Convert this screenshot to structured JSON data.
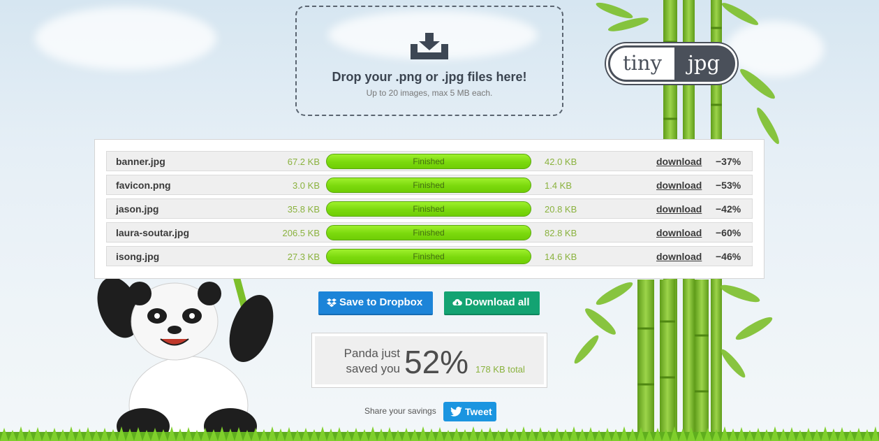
{
  "dropzone": {
    "icon": "download-tray-icon",
    "title": "Drop your .png or .jpg files here!",
    "subtitle": "Up to 20 images, max 5 MB each."
  },
  "logo": {
    "left": "tiny",
    "right": "jpg"
  },
  "files": [
    {
      "name": "banner.jpg",
      "original": "67.2 KB",
      "status": "Finished",
      "progress": 100,
      "compressed": "42.0 KB",
      "link": "download",
      "saving": "−37%"
    },
    {
      "name": "favicon.png",
      "original": "3.0 KB",
      "status": "Finished",
      "progress": 100,
      "compressed": "1.4 KB",
      "link": "download",
      "saving": "−53%"
    },
    {
      "name": "jason.jpg",
      "original": "35.8 KB",
      "status": "Finished",
      "progress": 100,
      "compressed": "20.8 KB",
      "link": "download",
      "saving": "−42%"
    },
    {
      "name": "laura-soutar.jpg",
      "original": "206.5 KB",
      "status": "Finished",
      "progress": 100,
      "compressed": "82.8 KB",
      "link": "download",
      "saving": "−60%"
    },
    {
      "name": "isong.jpg",
      "original": "27.3 KB",
      "status": "Finished",
      "progress": 100,
      "compressed": "14.6 KB",
      "link": "download",
      "saving": "−46%"
    }
  ],
  "actions": {
    "dropbox_label": "Save to Dropbox",
    "download_all_label": "Download all"
  },
  "savings": {
    "label_line1": "Panda just",
    "label_line2": "saved you",
    "percent": "52%",
    "total": "178 KB total"
  },
  "share": {
    "label": "Share your savings",
    "tweet_label": "Tweet"
  },
  "colors": {
    "progress_green": "#7bd90d",
    "size_green": "#8ab23e",
    "dropbox_blue": "#1c84d8",
    "download_green": "#13a372",
    "twitter_blue": "#1b95e0"
  }
}
